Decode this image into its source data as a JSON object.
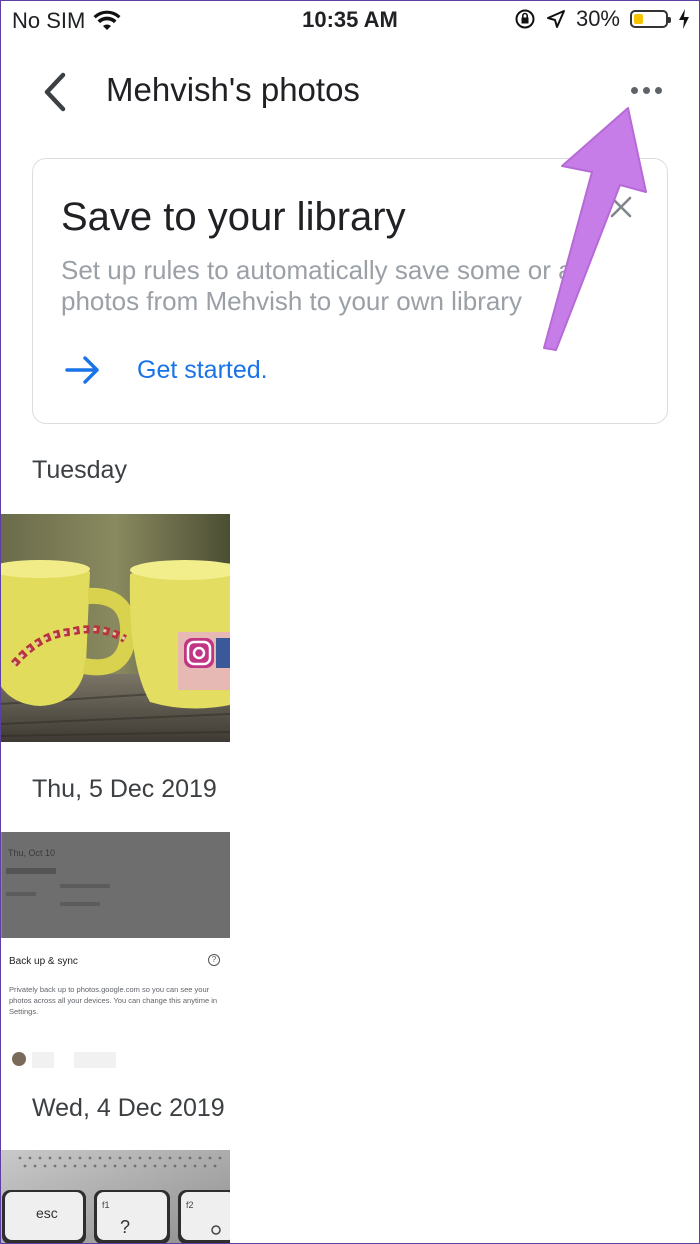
{
  "status_bar": {
    "carrier": "No SIM",
    "time": "10:35 AM",
    "battery_percent": "30%",
    "battery_level": 0.3,
    "icons": [
      "wifi-icon",
      "orientation-lock-icon",
      "location-icon",
      "battery-icon",
      "charging-icon"
    ]
  },
  "header": {
    "title": "Mehvish's photos",
    "back_icon": "chevron-left-icon",
    "more_icon": "more-horizontal-icon"
  },
  "card": {
    "title": "Save to your library",
    "description": "Set up rules to automatically save some or all photos from Mehvish to your own library",
    "cta_label": "Get started.",
    "close_icon": "close-icon",
    "cta_icon": "arrow-right-icon",
    "accent_color": "#1a73e8"
  },
  "sections": [
    {
      "label": "Tuesday"
    },
    {
      "label": "Thu, 5 Dec 2019"
    },
    {
      "label": "Wed, 4 Dec 2019"
    }
  ],
  "screenshot_thumb": {
    "heading": "Back up & sync",
    "body": "Privately back up to photos.google.com so you can see your photos across all your devices. You can change this anytime in Settings.",
    "top_text": "Thu, Oct 10"
  },
  "keyboard_thumb": {
    "keys": [
      "esc",
      "?"
    ]
  },
  "annotation_color": "#c77de8"
}
